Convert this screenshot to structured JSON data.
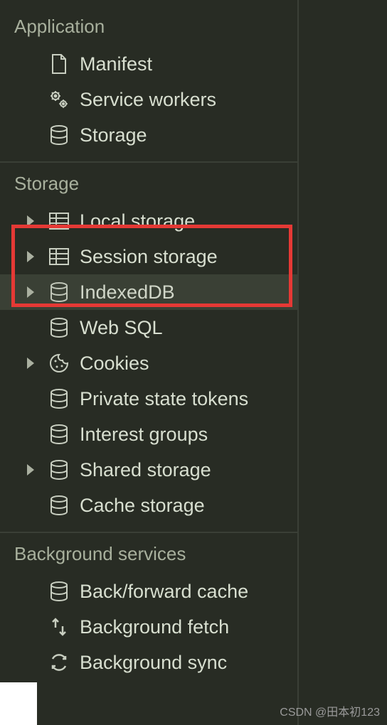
{
  "sections": {
    "application": {
      "title": "Application",
      "items": [
        {
          "label": "Manifest"
        },
        {
          "label": "Service workers"
        },
        {
          "label": "Storage"
        }
      ]
    },
    "storage": {
      "title": "Storage",
      "items": [
        {
          "label": "Local storage"
        },
        {
          "label": "Session storage"
        },
        {
          "label": "IndexedDB"
        },
        {
          "label": "Web SQL"
        },
        {
          "label": "Cookies"
        },
        {
          "label": "Private state tokens"
        },
        {
          "label": "Interest groups"
        },
        {
          "label": "Shared storage"
        },
        {
          "label": "Cache storage"
        }
      ]
    },
    "background": {
      "title": "Background services",
      "items": [
        {
          "label": "Back/forward cache"
        },
        {
          "label": "Background fetch"
        },
        {
          "label": "Background sync"
        }
      ]
    }
  },
  "watermark": "CSDN @田本初123"
}
